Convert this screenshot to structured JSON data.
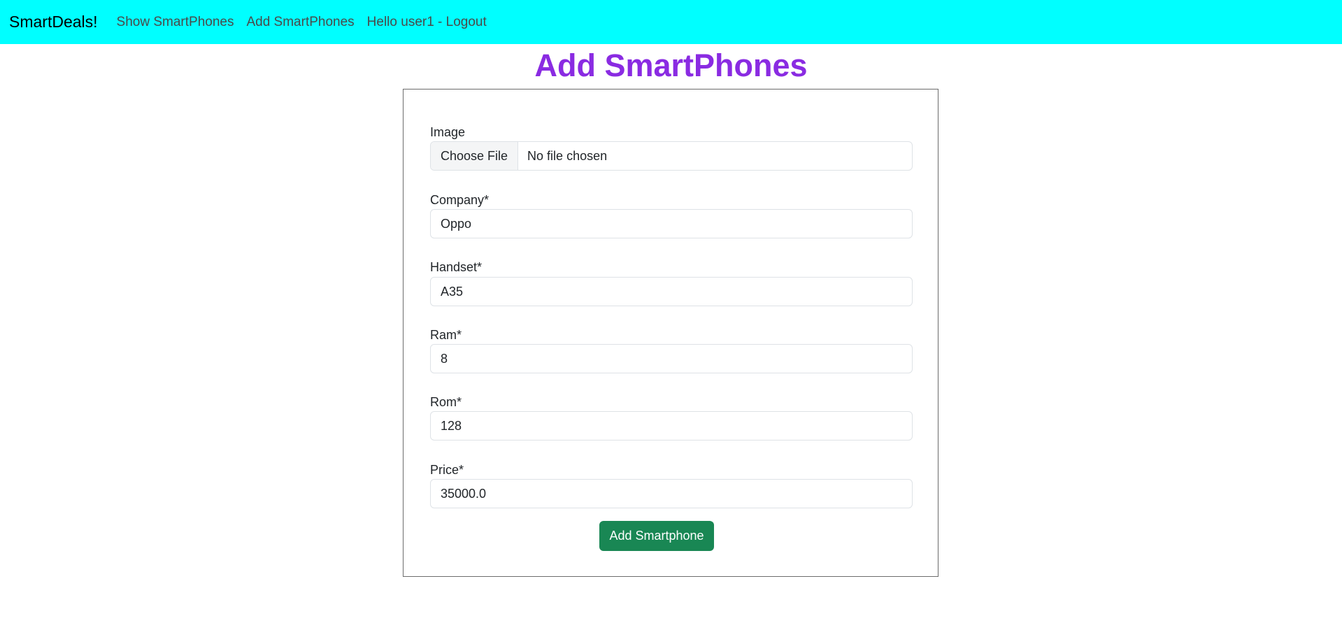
{
  "navbar": {
    "brand": "SmartDeals!",
    "links": [
      {
        "label": "Show SmartPhones"
      },
      {
        "label": "Add SmartPhones"
      },
      {
        "label": "Hello user1 - Logout"
      }
    ]
  },
  "page": {
    "title": "Add SmartPhones"
  },
  "form": {
    "image": {
      "label": "Image",
      "button_label": "Choose File",
      "status": "No file chosen"
    },
    "fields": [
      {
        "label": "Company*",
        "value": "Oppo"
      },
      {
        "label": "Handset*",
        "value": "A35"
      },
      {
        "label": "Ram*",
        "value": "8"
      },
      {
        "label": "Rom*",
        "value": "128"
      },
      {
        "label": "Price*",
        "value": "35000.0"
      }
    ],
    "submit_label": "Add Smartphone"
  },
  "colors": {
    "navbar_bg": "#00ffff",
    "title": "#8a2be2",
    "submit_bg": "#198754"
  }
}
